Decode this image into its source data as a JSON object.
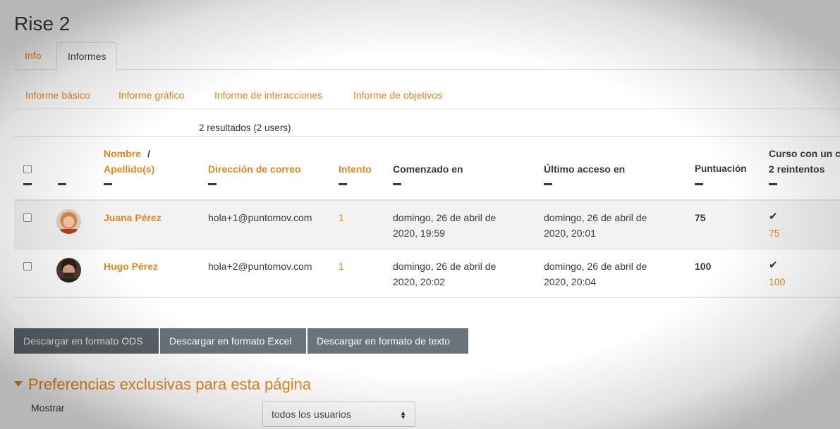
{
  "page": {
    "title": "Rise 2"
  },
  "tabs": [
    {
      "label": "Info"
    },
    {
      "label": "Informes"
    }
  ],
  "subnav": [
    {
      "label": "Informe básico"
    },
    {
      "label": "Informe gráfico"
    },
    {
      "label": "Informe de interacciones"
    },
    {
      "label": "Informe de objetivos"
    }
  ],
  "results": "2 resultados (2 users)",
  "table": {
    "headers": {
      "nombre": "Nombre",
      "slash": "/",
      "apellidos": "Apellido(s)",
      "correo": "Dirección de correo",
      "intento": "Intento",
      "comenzado": "Comenzado en",
      "ultimo": "Último acceso en",
      "puntuacion": "Puntuación",
      "curso_line1": "Curso con un c",
      "curso_line2": "2 reintentos"
    },
    "rows": [
      {
        "name": "Juana Pérez",
        "email": "hola+1@puntomov.com",
        "attempt": "1",
        "started_line1": "domingo, 26 de abril de",
        "started_line2": "2020, 19:59",
        "last_line1": "domingo, 26 de abril de",
        "last_line2": "2020, 20:01",
        "score": "75",
        "course_check": "✔",
        "course_score": "75"
      },
      {
        "name": "Hugo Pérez",
        "email": "hola+2@puntomov.com",
        "attempt": "1",
        "started_line1": "domingo, 26 de abril de",
        "started_line2": "2020, 20:02",
        "last_line1": "domingo, 26 de abril de",
        "last_line2": "2020, 20:04",
        "score": "100",
        "course_check": "✔",
        "course_score": "100"
      }
    ]
  },
  "buttons": {
    "ods": "Descargar en formato ODS",
    "excel": "Descargar en formato Excel",
    "text": "Descargar en formato de texto"
  },
  "preferences": {
    "title": "Preferencias exclusivas para esta página",
    "show_label": "Mostrar",
    "show_value": "todos los usuarios"
  },
  "icons": {
    "sort": "sort-dash-icon",
    "check": "check-icon",
    "select_caret": "select-caret-icon",
    "collapse": "collapse-triangle-icon"
  },
  "colors": {
    "accent": "#e8861a",
    "button": "#6a737b",
    "row_stripe": "#f2f2f2"
  }
}
